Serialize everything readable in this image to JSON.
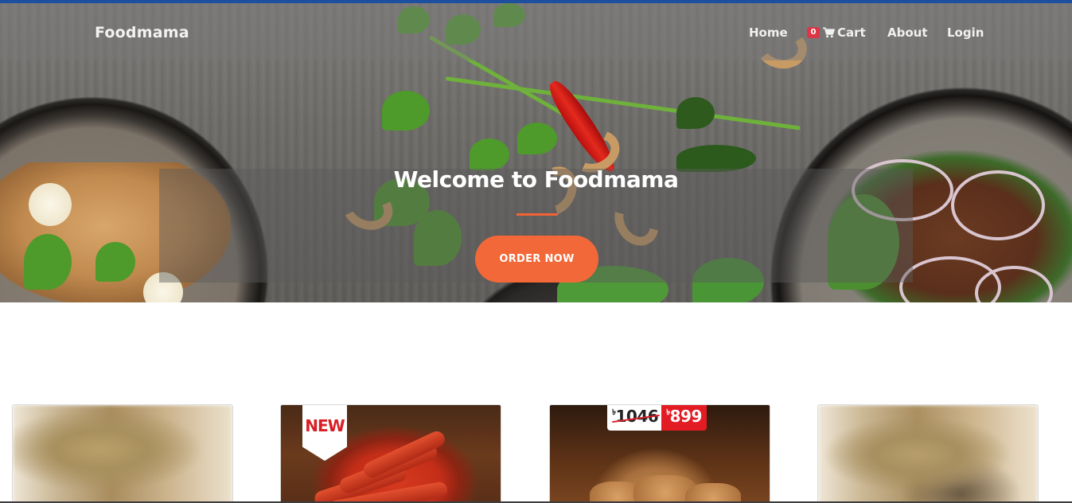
{
  "navbar": {
    "brand": "Foodmama",
    "links": {
      "home": "Home",
      "cart": "Cart",
      "cart_count": "0",
      "about": "About",
      "login": "Login"
    }
  },
  "hero": {
    "title": "Welcome to Foodmama",
    "cta_label": "ORDER NOW"
  },
  "cards": [
    {
      "badge": ""
    },
    {
      "badge": "NEW"
    },
    {
      "old_price": "1046",
      "new_price": "899",
      "currency": "৳"
    },
    {
      "badge": ""
    }
  ],
  "colors": {
    "accent": "#f26838",
    "badge": "#dc3545",
    "top_line": "#1c4fa0"
  },
  "icons": {
    "cart": "cart-icon"
  }
}
